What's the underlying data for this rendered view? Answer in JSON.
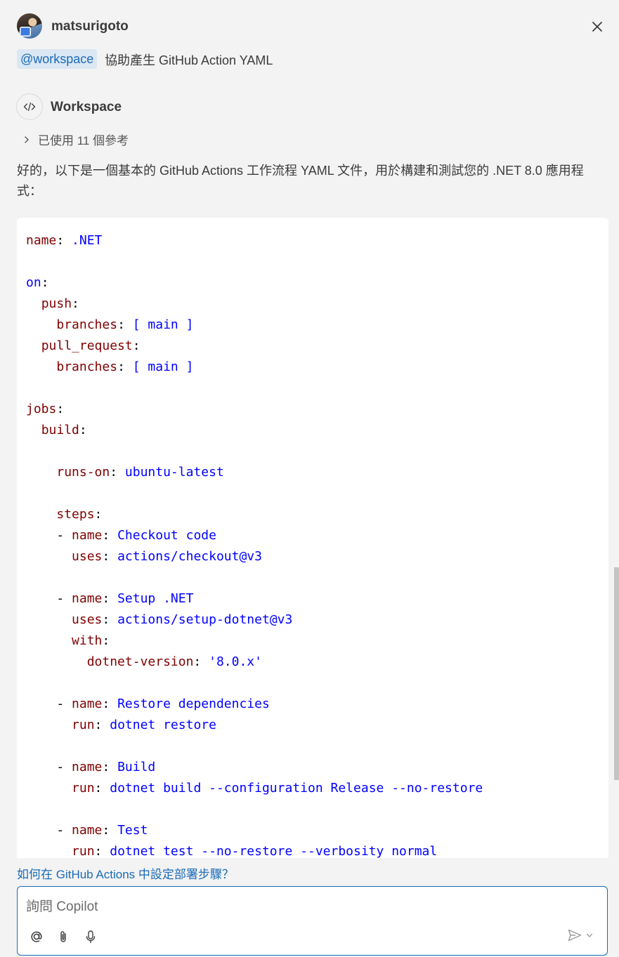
{
  "header": {
    "username": "matsurigoto",
    "close_icon": "close-icon"
  },
  "request": {
    "mention": "@workspace",
    "text": "協助產生 GitHub Action YAML"
  },
  "response": {
    "agent_name": "Workspace",
    "references_label": "已使用 11 個參考",
    "intro": "好的，以下是一個基本的 GitHub Actions 工作流程 YAML 文件，用於構建和測試您的 .NET 8.0 應用程式：",
    "code_lines": [
      [
        [
          "k",
          "name"
        ],
        [
          "p",
          ": "
        ],
        [
          "v",
          ".NET"
        ]
      ],
      [],
      [
        [
          "v",
          "on"
        ],
        [
          "p",
          ":"
        ]
      ],
      [
        [
          "p",
          "  "
        ],
        [
          "k",
          "push"
        ],
        [
          "p",
          ":"
        ]
      ],
      [
        [
          "p",
          "    "
        ],
        [
          "k",
          "branches"
        ],
        [
          "p",
          ": "
        ],
        [
          "v",
          "[ main ]"
        ]
      ],
      [
        [
          "p",
          "  "
        ],
        [
          "k",
          "pull_request"
        ],
        [
          "p",
          ":"
        ]
      ],
      [
        [
          "p",
          "    "
        ],
        [
          "k",
          "branches"
        ],
        [
          "p",
          ": "
        ],
        [
          "v",
          "[ main ]"
        ]
      ],
      [],
      [
        [
          "k",
          "jobs"
        ],
        [
          "p",
          ":"
        ]
      ],
      [
        [
          "p",
          "  "
        ],
        [
          "k",
          "build"
        ],
        [
          "p",
          ":"
        ]
      ],
      [],
      [
        [
          "p",
          "    "
        ],
        [
          "k",
          "runs-on"
        ],
        [
          "p",
          ": "
        ],
        [
          "v",
          "ubuntu-latest"
        ]
      ],
      [],
      [
        [
          "p",
          "    "
        ],
        [
          "k",
          "steps"
        ],
        [
          "p",
          ":"
        ]
      ],
      [
        [
          "p",
          "    - "
        ],
        [
          "k",
          "name"
        ],
        [
          "p",
          ": "
        ],
        [
          "v",
          "Checkout code"
        ]
      ],
      [
        [
          "p",
          "      "
        ],
        [
          "k",
          "uses"
        ],
        [
          "p",
          ": "
        ],
        [
          "v",
          "actions/checkout@v3"
        ]
      ],
      [],
      [
        [
          "p",
          "    - "
        ],
        [
          "k",
          "name"
        ],
        [
          "p",
          ": "
        ],
        [
          "v",
          "Setup .NET"
        ]
      ],
      [
        [
          "p",
          "      "
        ],
        [
          "k",
          "uses"
        ],
        [
          "p",
          ": "
        ],
        [
          "v",
          "actions/setup-dotnet@v3"
        ]
      ],
      [
        [
          "p",
          "      "
        ],
        [
          "k",
          "with"
        ],
        [
          "p",
          ":"
        ]
      ],
      [
        [
          "p",
          "        "
        ],
        [
          "k",
          "dotnet-version"
        ],
        [
          "p",
          ": "
        ],
        [
          "v",
          "'8.0.x'"
        ]
      ],
      [],
      [
        [
          "p",
          "    - "
        ],
        [
          "k",
          "name"
        ],
        [
          "p",
          ": "
        ],
        [
          "v",
          "Restore dependencies"
        ]
      ],
      [
        [
          "p",
          "      "
        ],
        [
          "k",
          "run"
        ],
        [
          "p",
          ": "
        ],
        [
          "v",
          "dotnet restore"
        ]
      ],
      [],
      [
        [
          "p",
          "    - "
        ],
        [
          "k",
          "name"
        ],
        [
          "p",
          ": "
        ],
        [
          "v",
          "Build"
        ]
      ],
      [
        [
          "p",
          "      "
        ],
        [
          "k",
          "run"
        ],
        [
          "p",
          ": "
        ],
        [
          "v",
          "dotnet build --configuration Release --no-restore"
        ]
      ],
      [],
      [
        [
          "p",
          "    - "
        ],
        [
          "k",
          "name"
        ],
        [
          "p",
          ": "
        ],
        [
          "v",
          "Test"
        ]
      ],
      [
        [
          "p",
          "      "
        ],
        [
          "k",
          "run"
        ],
        [
          "p",
          ": "
        ],
        [
          "v",
          "dotnet test --no-restore --verbosity normal"
        ]
      ]
    ]
  },
  "suggestion": "如何在 GitHub Actions 中設定部署步驟？",
  "chat": {
    "placeholder": "詢問 Copilot",
    "value": ""
  },
  "colors": {
    "accent": "#1a6bb8",
    "yaml_key": "#800000",
    "yaml_value": "#0000ff"
  }
}
